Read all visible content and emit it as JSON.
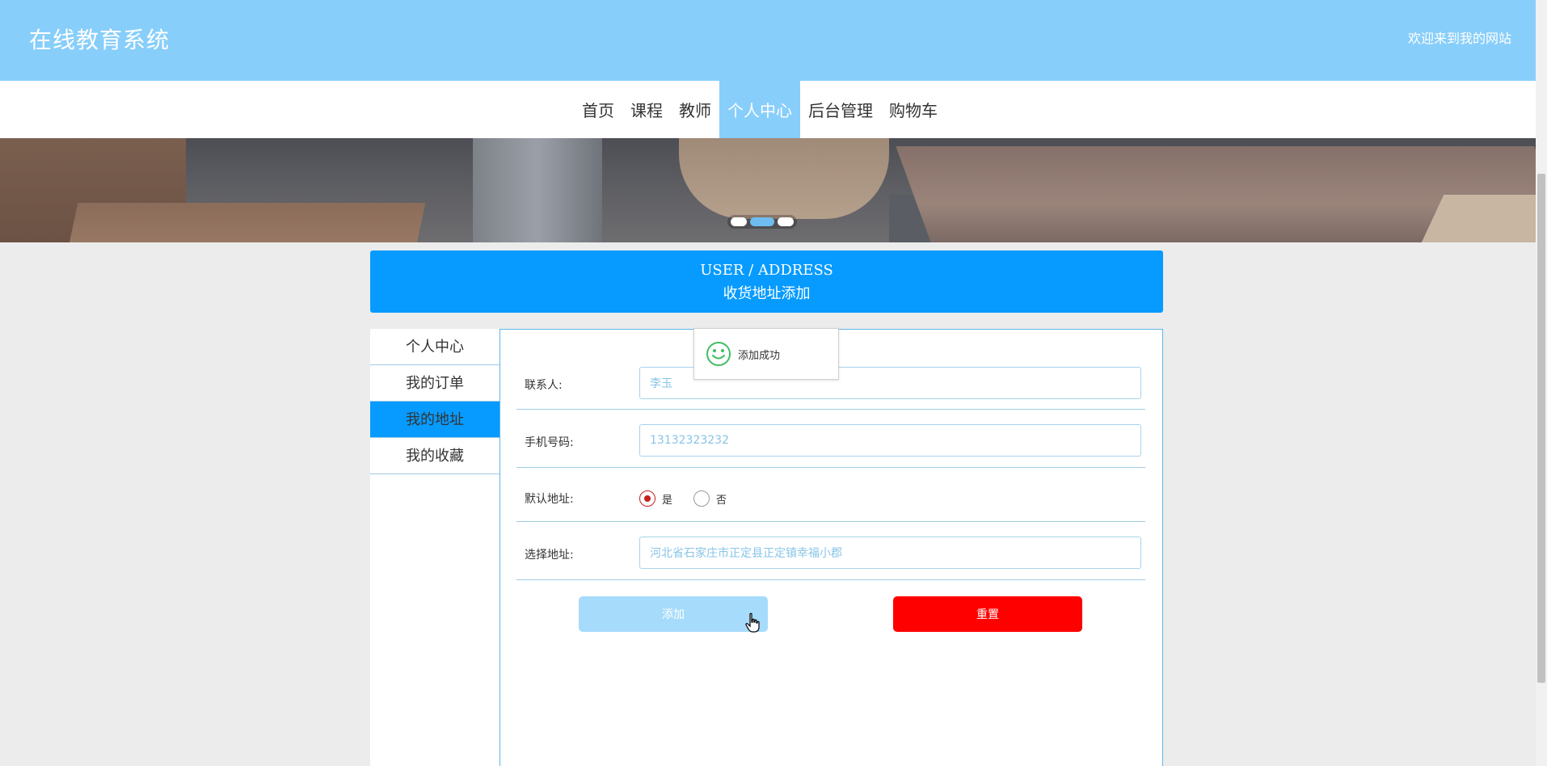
{
  "header": {
    "site_title": "在线教育系统",
    "welcome": "欢迎来到我的网站"
  },
  "nav": {
    "items": [
      {
        "label": "首页"
      },
      {
        "label": "课程"
      },
      {
        "label": "教师"
      },
      {
        "label": "个人中心",
        "active": true
      },
      {
        "label": "后台管理"
      },
      {
        "label": "购物车"
      }
    ]
  },
  "banner": {
    "slide_count": 3,
    "active_slide": 2
  },
  "title_band": {
    "en": "USER / ADDRESS",
    "cn": "收货地址添加"
  },
  "side_menu": {
    "items": [
      {
        "label": "个人中心"
      },
      {
        "label": "我的订单"
      },
      {
        "label": "我的地址",
        "active": true
      },
      {
        "label": "我的收藏"
      }
    ]
  },
  "form": {
    "contact": {
      "label": "联系人:",
      "value": "李玉"
    },
    "phone": {
      "label": "手机号码:",
      "value": "13132323232"
    },
    "default_address": {
      "label": "默认地址:",
      "options": [
        {
          "label": "是",
          "checked": true
        },
        {
          "label": "否",
          "checked": false
        }
      ]
    },
    "address": {
      "label": "选择地址:",
      "value": "河北省石家庄市正定县正定镇幸福小郡"
    },
    "add_button": "添加",
    "reset_button": "重置"
  },
  "toast": {
    "message": "添加成功",
    "icon": "smile-icon"
  },
  "colors": {
    "header_bg": "#88cefa",
    "primary": "#079bff",
    "reset": "#ff0000",
    "add_disabled": "#a6dbfb",
    "radio_checked": "#c81e1e"
  }
}
